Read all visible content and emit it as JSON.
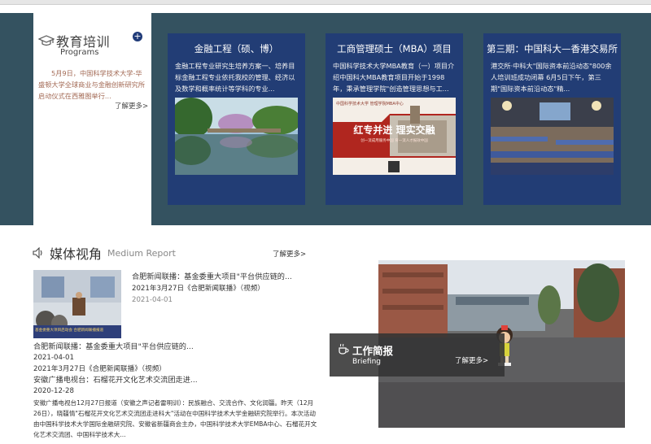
{
  "training": {
    "title": "教育培训",
    "subtitle": "Programs",
    "text": "5月9日，中国科学技术大学-华盛顿大学全球商业与金融创新研究所启动仪式在西雅图举行...",
    "more": "了解更多>",
    "icon": "graduation-cap-icon"
  },
  "programs": [
    {
      "title": "金融工程（硕、博）",
      "desc": "金融工程专业研究生培养方案一、培养目标金融工程专业依托我校的管理、经济以及数学和概率统计等学科的专业..."
    },
    {
      "title": "工商管理硕士（MBA）项目",
      "desc": "中国科学技术大学MBA教育（一）项目介绍中国科大MBA教育项目开始于1998年，秉承管理学院\"创造管理思想与工...",
      "banner_main": "红专并进 理实交融",
      "banner_sub": "创一流成用服务中国   育一流人才报效中国",
      "banner_logo": "中国科学技术大学 管理学院MBA中心"
    },
    {
      "title": "第三期：中国科大—香港交易所",
      "desc": "港交所·中科大\"国际资本前沿动态\"800余人培训班成功闭幕 6月5日下午，第三期\"国际资本前沿动态\"精..."
    }
  ],
  "media": {
    "title": "媒体视角",
    "subtitle": "Medium Report",
    "more": "了解更多>",
    "icon": "speaker-icon",
    "featured": {
      "title": "合肥新闻联播：基金委重大项目\"平台供应链的...",
      "source": "2021年3月27日《合肥新闻联播》（视频）",
      "date": "2021-04-01",
      "thumb_caption": "基金委重大项目启动会 合肥新闻联播报道"
    },
    "items": [
      {
        "title": "合肥新闻联播：基金委重大项目\"平台供应链的...",
        "date": "2021-04-01",
        "desc": "2021年3月27日《合肥新闻联播》（视频）"
      },
      {
        "title": "安徽广播电视台：石榴花开文化艺术交流团走进...",
        "date": "2020-12-28",
        "desc": "安徽广播电视台12月27日报道（安徽之声记者雷明训）：民族融合、交流合作、文化润疆。昨天（12月26日），晓疆情\"石榴花开文化艺术交流团走进科大\"活动在中国科学技术大学金融研究院举行。本次活动由中国科学技术大学国际金融研究院、安徽省新疆商会主办，中国科学技术大学EMBA中心、石榴花开文化艺术交流团、中国科学技术大..."
      }
    ]
  },
  "briefing": {
    "title": "工作简报",
    "subtitle": "Briefing",
    "more": "了解更多>",
    "icon": "coffee-cup-icon"
  }
}
